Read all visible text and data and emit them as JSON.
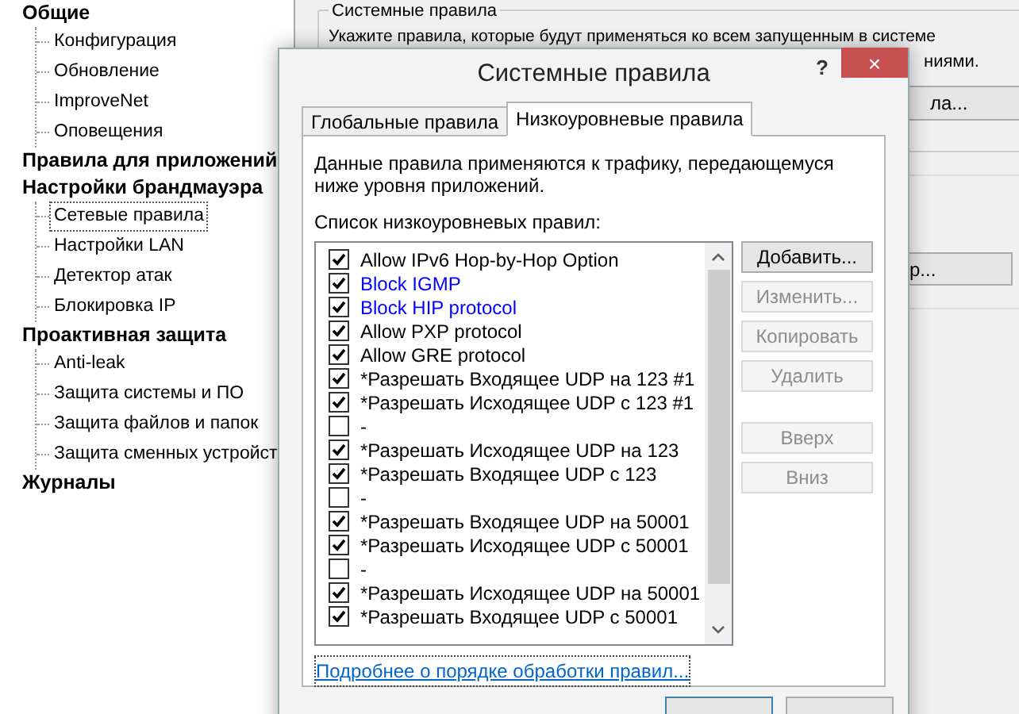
{
  "tree": [
    {
      "label": "Общие",
      "children": [
        {
          "label": "Конфигурация",
          "selected": false
        },
        {
          "label": "Обновление",
          "selected": false
        },
        {
          "label": "ImproveNet",
          "selected": false
        },
        {
          "label": "Оповещения",
          "selected": false
        }
      ]
    },
    {
      "label": "Правила для приложений"
    },
    {
      "label": "Настройки брандмауэра",
      "children": [
        {
          "label": "Сетевые правила",
          "selected": true
        },
        {
          "label": "Настройки LAN",
          "selected": false
        },
        {
          "label": "Детектор атак",
          "selected": false
        },
        {
          "label": "Блокировка IP",
          "selected": false
        }
      ]
    },
    {
      "label": "Проактивная защита",
      "children": [
        {
          "label": "Anti-leak",
          "selected": false
        },
        {
          "label": "Защита системы и ПО",
          "selected": false
        },
        {
          "label": "Защита файлов и папок",
          "selected": false
        },
        {
          "label": "Защита сменных устройст",
          "selected": false
        }
      ]
    },
    {
      "label": "Журналы"
    }
  ],
  "background": {
    "group_title": "Системные правила",
    "description": "Укажите правила, которые будут применяться ко всем запущенным в системе",
    "description_tail": "ниями.",
    "button_1": "ла...",
    "button_2": "р..."
  },
  "dialog": {
    "title": "Системные правила",
    "help": "?",
    "close": "×",
    "tabs": [
      {
        "label": "Глобальные правила",
        "selected": false
      },
      {
        "label": "Низкоуровневые правила",
        "selected": true
      }
    ],
    "description": "Данные правила применяются к трафику, передающемуся ниже уровня приложений.",
    "list_label": "Список низкоуровневых правил:",
    "rules": [
      {
        "label": "Allow IPv6 Hop-by-Hop Option",
        "checked": true,
        "color": "#000000"
      },
      {
        "label": "Block IGMP",
        "checked": true,
        "color": "#0000ff"
      },
      {
        "label": "Block HIP protocol",
        "checked": true,
        "color": "#0000ff"
      },
      {
        "label": "Allow PXP protocol",
        "checked": true,
        "color": "#000000"
      },
      {
        "label": "Allow GRE protocol",
        "checked": true,
        "color": "#000000"
      },
      {
        "label": "*Разрешать Входящее UDP на 123 #1",
        "checked": true,
        "color": "#000000"
      },
      {
        "label": "*Разрешать Исходящее UDP с 123 #1",
        "checked": true,
        "color": "#000000"
      },
      {
        "label": "-",
        "checked": false,
        "color": "#000000"
      },
      {
        "label": "*Разрешать Исходящее UDP на 123",
        "checked": true,
        "color": "#000000"
      },
      {
        "label": "*Разрешать Входящее UDP с 123",
        "checked": true,
        "color": "#000000"
      },
      {
        "label": "-",
        "checked": false,
        "color": "#000000"
      },
      {
        "label": "*Разрешать Входящее UDP на 50001",
        "checked": true,
        "color": "#000000"
      },
      {
        "label": "*Разрешать Исходящее UDP с 50001",
        "checked": true,
        "color": "#000000"
      },
      {
        "label": "-",
        "checked": false,
        "color": "#000000"
      },
      {
        "label": "*Разрешать Исходящее UDP на 50001",
        "checked": true,
        "color": "#000000"
      },
      {
        "label": "*Разрешать Входящее UDP с 50001",
        "checked": true,
        "color": "#000000"
      }
    ],
    "buttons": [
      {
        "label": "Добавить...",
        "disabled": false
      },
      {
        "label": "Изменить...",
        "disabled": true
      },
      {
        "label": "Копировать",
        "disabled": true
      },
      {
        "label": "Удалить",
        "disabled": true
      },
      {
        "label": "Вверх",
        "disabled": true
      },
      {
        "label": "Вниз",
        "disabled": true
      }
    ],
    "link": "Подробнее о порядке обработки правил..."
  }
}
